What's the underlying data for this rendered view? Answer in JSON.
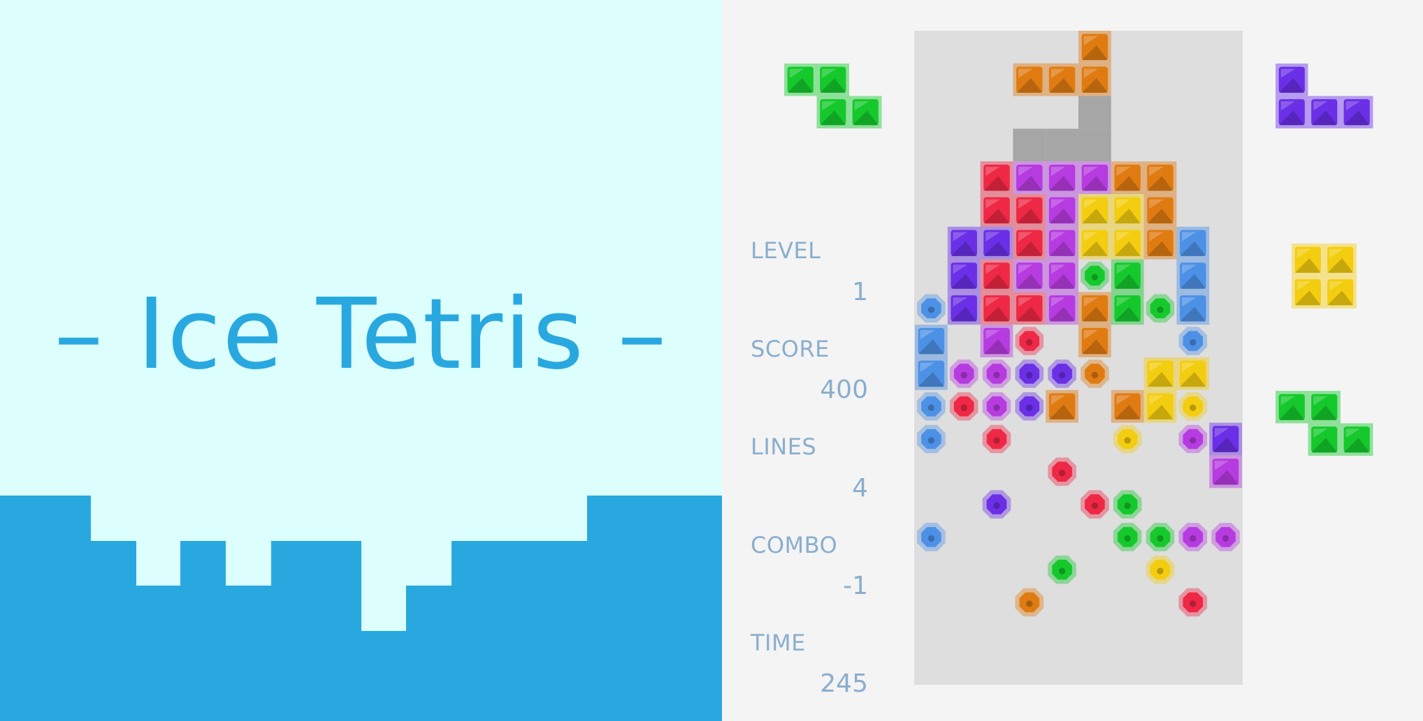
{
  "title": {
    "text": "– Ice Tetris –"
  },
  "stats": [
    {
      "key": "level",
      "label": "LEVEL",
      "value": "1"
    },
    {
      "key": "score",
      "label": "SCORE",
      "value": "400"
    },
    {
      "key": "lines",
      "label": "LINES",
      "value": "4"
    },
    {
      "key": "combo",
      "label": "COMBO",
      "value": "-1"
    },
    {
      "key": "time",
      "label": "TIME",
      "value": "245"
    }
  ],
  "colors": {
    "title_bg": "#dcfffe",
    "title_accent": "#29a8e0",
    "game_bg": "#f4f4f4",
    "board_bg": "#dedede",
    "ghost": "#a6a6a6",
    "stat_text": "#8aaecd",
    "orange": "#e07b12",
    "red": "#ee2845",
    "purple": "#b63be0",
    "yellow": "#f3cd0f",
    "blue": "#4d91e6",
    "green": "#15c92c",
    "violet": "#6a2fe6"
  },
  "board": {
    "cols": 10,
    "rows": 20,
    "active_piece": {
      "color": "orange",
      "cells": [
        [
          5,
          0
        ],
        [
          3,
          1
        ],
        [
          4,
          1
        ],
        [
          5,
          1
        ]
      ]
    },
    "ghost_piece": {
      "cells": [
        [
          5,
          2
        ],
        [
          3,
          3
        ],
        [
          4,
          3
        ],
        [
          5,
          3
        ]
      ]
    },
    "cells": [
      [
        2,
        4,
        "red",
        "block"
      ],
      [
        3,
        4,
        "purple",
        "block"
      ],
      [
        4,
        4,
        "purple",
        "block"
      ],
      [
        5,
        4,
        "purple",
        "block"
      ],
      [
        6,
        4,
        "orange",
        "block"
      ],
      [
        7,
        4,
        "orange",
        "block"
      ],
      [
        2,
        5,
        "red",
        "block"
      ],
      [
        3,
        5,
        "red",
        "block"
      ],
      [
        4,
        5,
        "purple",
        "block"
      ],
      [
        5,
        5,
        "yellow",
        "block"
      ],
      [
        6,
        5,
        "yellow",
        "block"
      ],
      [
        7,
        5,
        "orange",
        "block"
      ],
      [
        1,
        6,
        "violet",
        "block"
      ],
      [
        2,
        6,
        "violet",
        "block"
      ],
      [
        3,
        6,
        "red",
        "block"
      ],
      [
        4,
        6,
        "purple",
        "block"
      ],
      [
        5,
        6,
        "yellow",
        "block"
      ],
      [
        6,
        6,
        "yellow",
        "block"
      ],
      [
        7,
        6,
        "orange",
        "block"
      ],
      [
        8,
        6,
        "blue",
        "block"
      ],
      [
        1,
        7,
        "violet",
        "block"
      ],
      [
        2,
        7,
        "red",
        "block"
      ],
      [
        3,
        7,
        "purple",
        "block"
      ],
      [
        4,
        7,
        "purple",
        "block"
      ],
      [
        5,
        7,
        "green",
        "gem"
      ],
      [
        6,
        7,
        "green",
        "block"
      ],
      [
        8,
        7,
        "blue",
        "block"
      ],
      [
        0,
        8,
        "blue",
        "gem"
      ],
      [
        1,
        8,
        "violet",
        "block"
      ],
      [
        2,
        8,
        "red",
        "block"
      ],
      [
        3,
        8,
        "red",
        "block"
      ],
      [
        4,
        8,
        "purple",
        "block"
      ],
      [
        5,
        8,
        "orange",
        "block"
      ],
      [
        6,
        8,
        "green",
        "block"
      ],
      [
        7,
        8,
        "green",
        "gem"
      ],
      [
        8,
        8,
        "blue",
        "block"
      ],
      [
        0,
        9,
        "blue",
        "block"
      ],
      [
        2,
        9,
        "purple",
        "block"
      ],
      [
        3,
        9,
        "red",
        "gem"
      ],
      [
        5,
        9,
        "orange",
        "block"
      ],
      [
        8,
        9,
        "blue",
        "gem"
      ],
      [
        0,
        10,
        "blue",
        "block"
      ],
      [
        1,
        10,
        "purple",
        "gem"
      ],
      [
        2,
        10,
        "purple",
        "gem"
      ],
      [
        3,
        10,
        "violet",
        "gem"
      ],
      [
        4,
        10,
        "violet",
        "gem"
      ],
      [
        5,
        10,
        "orange",
        "gem"
      ],
      [
        7,
        10,
        "yellow",
        "block"
      ],
      [
        8,
        10,
        "yellow",
        "block"
      ],
      [
        0,
        11,
        "blue",
        "gem"
      ],
      [
        1,
        11,
        "red",
        "gem"
      ],
      [
        2,
        11,
        "purple",
        "gem"
      ],
      [
        3,
        11,
        "violet",
        "gem"
      ],
      [
        4,
        11,
        "orange",
        "block"
      ],
      [
        6,
        11,
        "orange",
        "block"
      ],
      [
        7,
        11,
        "yellow",
        "block"
      ],
      [
        8,
        11,
        "yellow",
        "gem"
      ],
      [
        0,
        12,
        "blue",
        "gem"
      ],
      [
        2,
        12,
        "red",
        "gem"
      ],
      [
        6,
        12,
        "yellow",
        "gem"
      ],
      [
        8,
        12,
        "purple",
        "gem"
      ],
      [
        9,
        12,
        "violet",
        "block"
      ],
      [
        4,
        13,
        "red",
        "gem"
      ],
      [
        9,
        13,
        "purple",
        "block"
      ],
      [
        2,
        14,
        "violet",
        "gem"
      ],
      [
        5,
        14,
        "red",
        "gem"
      ],
      [
        6,
        14,
        "green",
        "gem"
      ],
      [
        0,
        15,
        "blue",
        "gem"
      ],
      [
        6,
        15,
        "green",
        "gem"
      ],
      [
        7,
        15,
        "green",
        "gem"
      ],
      [
        8,
        15,
        "purple",
        "gem"
      ],
      [
        9,
        15,
        "purple",
        "gem"
      ],
      [
        4,
        16,
        "green",
        "gem"
      ],
      [
        7,
        16,
        "yellow",
        "gem"
      ],
      [
        3,
        17,
        "orange",
        "gem"
      ],
      [
        8,
        17,
        "red",
        "gem"
      ]
    ]
  },
  "hold_piece": {
    "name": "S",
    "color": "green",
    "cells": [
      [
        0,
        0
      ],
      [
        1,
        0
      ],
      [
        1,
        1
      ],
      [
        2,
        1
      ]
    ]
  },
  "next_queue": [
    {
      "name": "J",
      "color": "violet",
      "cells": [
        [
          0,
          0
        ],
        [
          0,
          1
        ],
        [
          1,
          1
        ],
        [
          2,
          1
        ]
      ]
    },
    {
      "name": "O",
      "color": "yellow",
      "cells": [
        [
          0,
          0
        ],
        [
          1,
          0
        ],
        [
          0,
          1
        ],
        [
          1,
          1
        ]
      ]
    },
    {
      "name": "S",
      "color": "green",
      "cells": [
        [
          0,
          0
        ],
        [
          1,
          0
        ],
        [
          1,
          1
        ],
        [
          2,
          1
        ]
      ]
    }
  ]
}
